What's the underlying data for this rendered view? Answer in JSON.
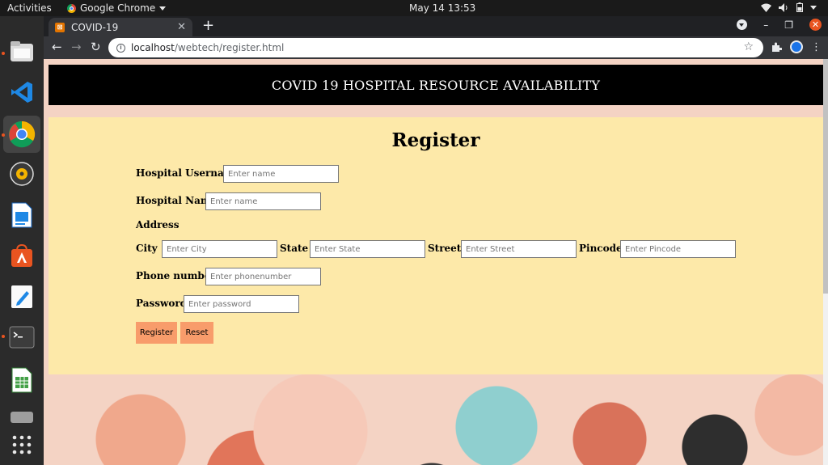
{
  "topbar": {
    "activities": "Activities",
    "app_name": "Google Chrome",
    "clock": "May 14  13:53"
  },
  "browser": {
    "tab_title": "COVID-19",
    "url_host": "localhost",
    "url_path": "/webtech/register.html"
  },
  "page": {
    "header": "COVID 19 HOSPITAL RESOURCE AVAILABILITY",
    "form_title": "Register",
    "fields": {
      "username_label": "Hospital Username",
      "username_placeholder": "Enter name",
      "hospital_name_label": "Hospital Name",
      "hospital_name_placeholder": "Enter name",
      "address_label": "Address",
      "city_label": "City",
      "city_placeholder": "Enter City",
      "state_label": "State",
      "state_placeholder": "Enter State",
      "street_label": "Street",
      "street_placeholder": "Enter Street",
      "pincode_label": "Pincode",
      "pincode_placeholder": "Enter Pincode",
      "phone_label": "Phone number",
      "phone_placeholder": "Enter phonenumber",
      "password_label": "Password",
      "password_placeholder": "Enter password"
    },
    "buttons": {
      "register": "Register",
      "reset": "Reset"
    }
  }
}
